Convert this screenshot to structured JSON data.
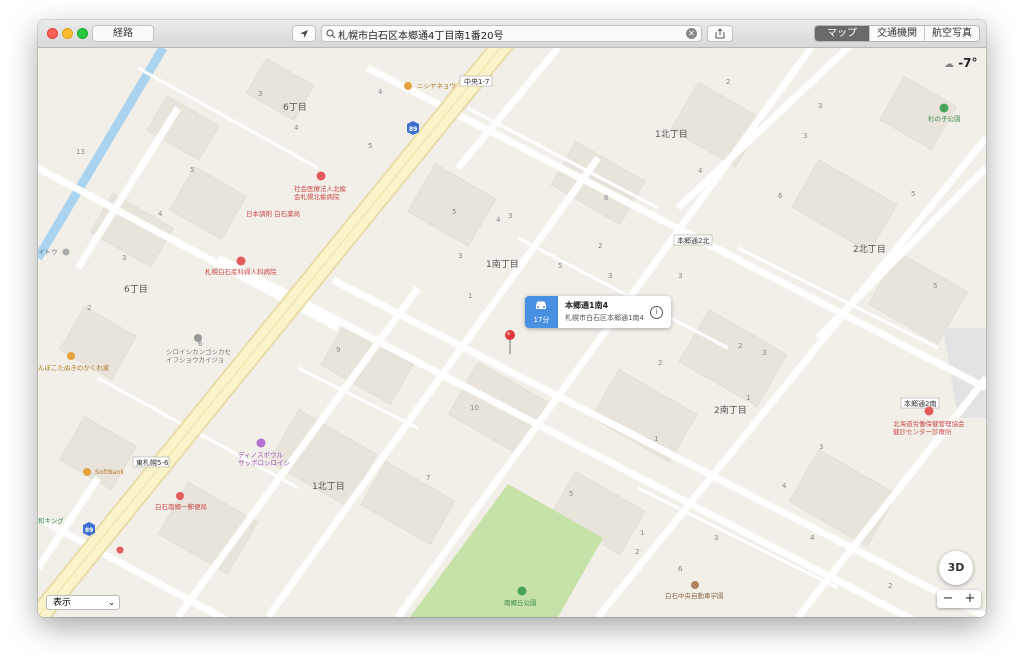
{
  "window": {
    "directions_button": "経路",
    "search_value": "札幌市白石区本郷通4丁目南1番20号",
    "view_modes": [
      {
        "label": "マップ",
        "active": true
      },
      {
        "label": "交通機関",
        "active": false
      },
      {
        "label": "航空写真",
        "active": false
      }
    ]
  },
  "weather": {
    "temp": "-7°",
    "icon": "partly-cloudy-icon"
  },
  "map": {
    "areas": [
      "6丁目",
      "6丁目",
      "1北丁目",
      "1南丁目",
      "2北丁目",
      "2南丁目",
      "1北丁目"
    ],
    "block_numbers": [
      "3",
      "4",
      "5",
      "13",
      "5",
      "4",
      "3",
      "2",
      "6",
      "9",
      "10",
      "7",
      "1",
      "5",
      "2",
      "3",
      "4",
      "1",
      "2",
      "5",
      "3",
      "2",
      "4",
      "3",
      "1",
      "5",
      "3",
      "4",
      "2",
      "4",
      "3",
      "4",
      "2",
      "6",
      "1",
      "6",
      "5",
      "3",
      "5",
      "6",
      "3",
      "3",
      "1",
      "2",
      "3"
    ],
    "stops": [
      "中央1-7",
      "本郷通2北",
      "本郷通2南",
      "東札幌5-6"
    ],
    "route_shields": [
      "89",
      "89"
    ],
    "pois": [
      {
        "label": "ニシヤネョウ",
        "color": "#e6a23c"
      },
      {
        "label": "社会医療法人北楡\n会札幌北楡病院",
        "color": "#e25c5c"
      },
      {
        "label": "日本調剤 白石薬局",
        "color": "#e25c5c"
      },
      {
        "label": "札幌白石産科婦人科病院",
        "color": "#e25c5c"
      },
      {
        "label": "シロイシカンゴシカセ\nイフショウカイジョ",
        "color": "#888"
      },
      {
        "label": "ディノスボウル\nサッポロシロイシ",
        "color": "#b56fd0"
      },
      {
        "label": "SoftBank",
        "color": "#e6a23c"
      },
      {
        "label": "白石南郷一郵便局",
        "color": "#e25c5c"
      },
      {
        "label": "北海道労働保健管理協会\n健診センター診療所",
        "color": "#e25c5c"
      },
      {
        "label": "白石中央自動車学園",
        "color": "#b0845e"
      },
      {
        "label": "南郷丘公園",
        "color": "#4aa35a"
      },
      {
        "label": "杉の子公園",
        "color": "#4aa35a"
      },
      {
        "label": "んぽこたぬきのかくれ家",
        "color": "#e6a23c"
      },
      {
        "label": "イトウ",
        "color": "#888"
      },
      {
        "label": "和キング",
        "color": "#4aa35a"
      }
    ],
    "callout": {
      "title": "本郷通1南4",
      "address": "札幌市白石区本郷通1南4",
      "eta": "17分"
    },
    "controls": {
      "three_d": "3D",
      "zoom_out": "−",
      "zoom_in": "+",
      "display": "表示"
    }
  }
}
